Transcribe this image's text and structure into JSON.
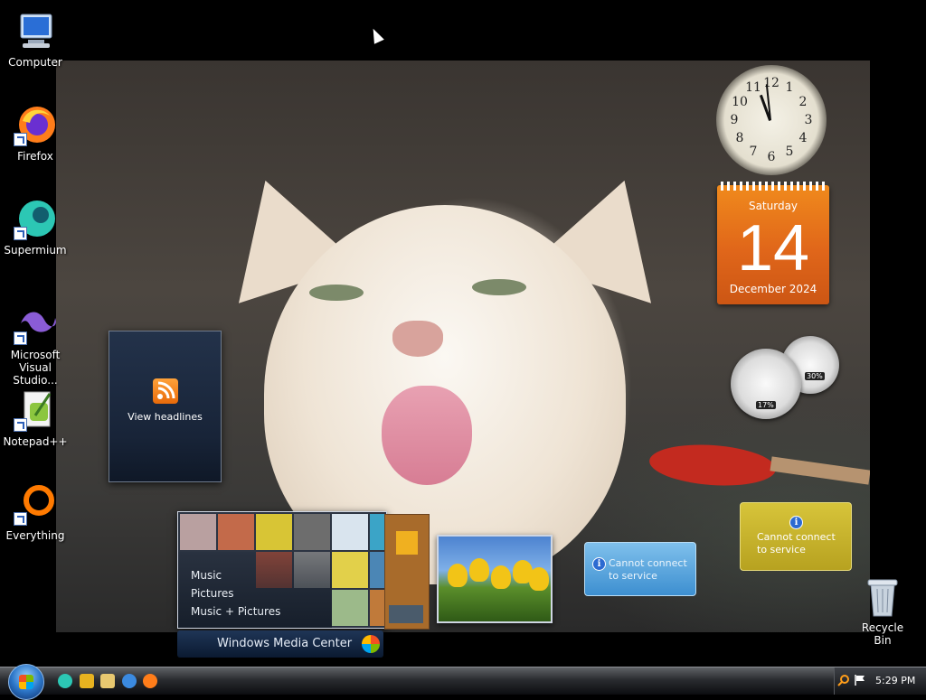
{
  "desktop": {
    "icons": [
      {
        "label": "Computer",
        "icon": "computer-icon"
      },
      {
        "label": "Firefox",
        "icon": "firefox-icon"
      },
      {
        "label": "Supermium",
        "icon": "supermium-icon"
      },
      {
        "label": "Microsoft Visual Studio...",
        "icon": "visual-studio-icon"
      },
      {
        "label": "Notepad++",
        "icon": "notepadpp-icon"
      },
      {
        "label": "Everything",
        "icon": "everything-icon"
      }
    ],
    "recycle_bin": {
      "label": "Recycle Bin",
      "icon": "recycle-bin-icon"
    }
  },
  "gadgets": {
    "clock": {
      "numbers": [
        "12",
        "1",
        "2",
        "3",
        "4",
        "5",
        "6",
        "7",
        "8",
        "9",
        "10",
        "11"
      ]
    },
    "calendar": {
      "weekday": "Saturday",
      "day": "14",
      "month_year": "December 2024"
    },
    "cpu_meter": {
      "cpu_percent": "17%",
      "memory_percent": "30%"
    },
    "feed": {
      "label": "View headlines"
    },
    "media_center": {
      "menu": [
        "Music",
        "Pictures",
        "Music + Pictures"
      ],
      "title": "Windows Media Center"
    },
    "stocks": {
      "message": "Cannot connect to service"
    },
    "weather": {
      "message": "Cannot connect to service"
    }
  },
  "taskbar": {
    "clock": "5:29 PM",
    "quick_launch": [
      "supermium-icon",
      "media-player-icon",
      "folder-icon",
      "ie-icon",
      "firefox-icon"
    ]
  },
  "colors": {
    "calendar_orange": "#e0661a",
    "taskbar_dark": "#0c0d10",
    "feed_navy": "#182438"
  }
}
